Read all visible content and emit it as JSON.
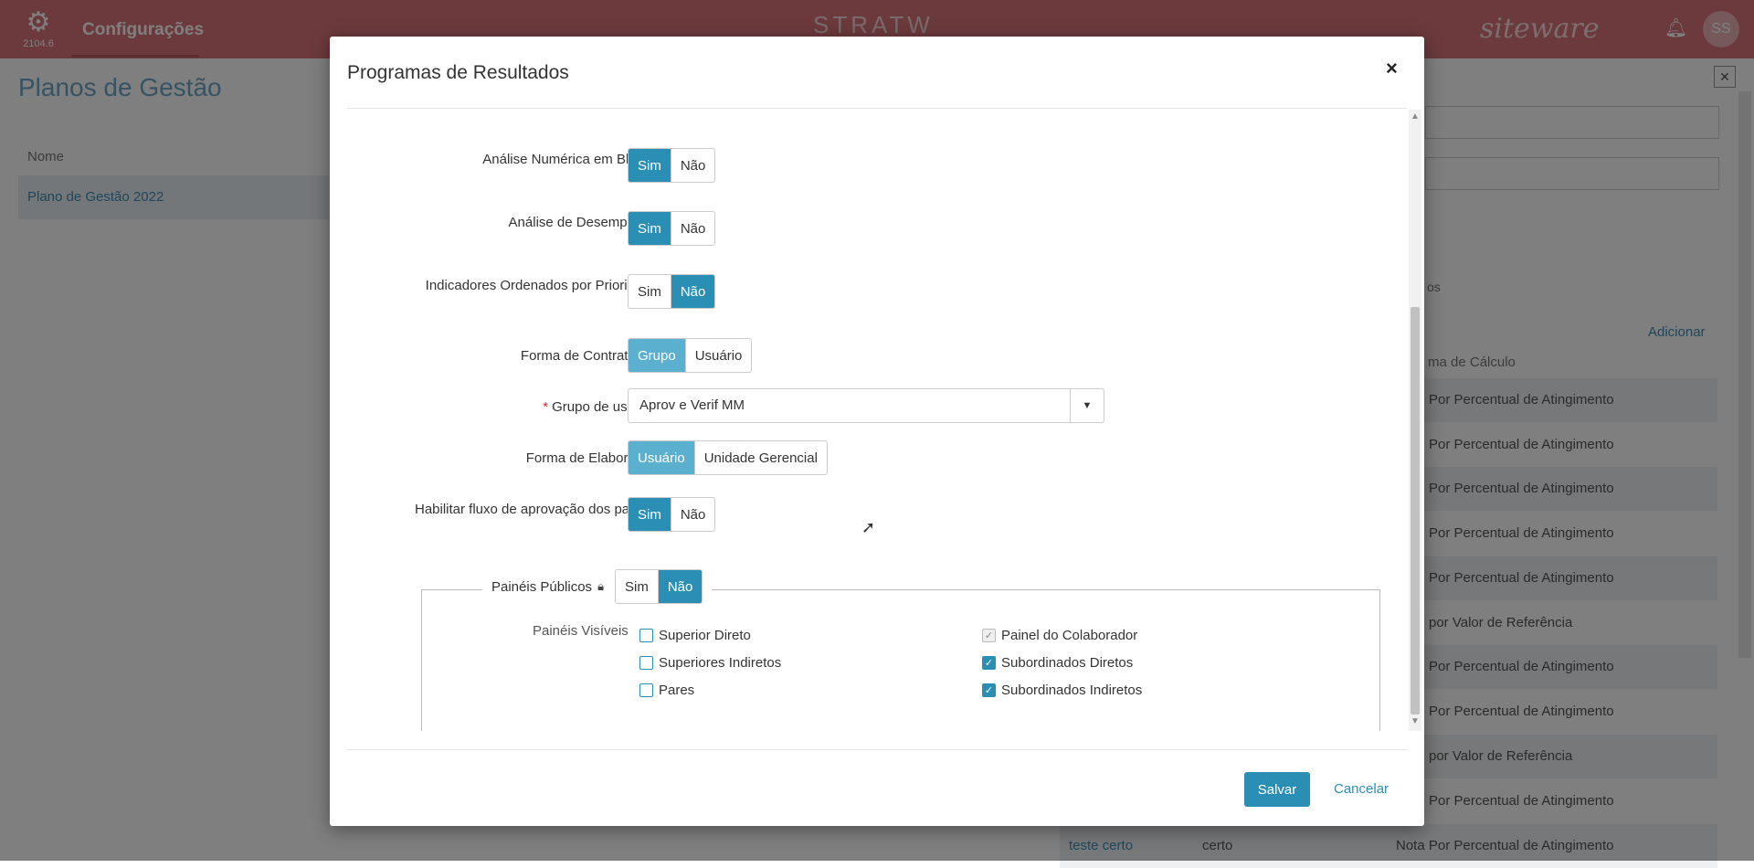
{
  "app": {
    "version": "2104.6",
    "title": "Configurações",
    "logo_text": "STRATW",
    "brand": "siteware",
    "avatar_initials": "SS"
  },
  "background": {
    "page_title": "Planos de Gestão",
    "column_name": "Nome",
    "plan_row": "Plano de Gestão 2022",
    "add_link": "Adicionar",
    "calc_header": "ma de Cálculo",
    "tab_partial": "os",
    "rows": [
      "Por Percentual de Atingimento",
      "Por Percentual de Atingimento",
      "Por Percentual de Atingimento",
      "Por Percentual de Atingimento",
      "Por Percentual de Atingimento",
      "por Valor de Referência",
      "Por Percentual de Atingimento",
      "Por Percentual de Atingimento",
      "por Valor de Referência",
      "Por Percentual de Atingimento"
    ],
    "last_row": {
      "name": "teste certo",
      "value": "certo",
      "calc": "Nota Por Percentual de Atingimento"
    }
  },
  "modal": {
    "title": "Programas de Resultados",
    "close_label": "×",
    "fields": {
      "analise_numerica": {
        "label": "Análise Numérica em Blocos",
        "options": [
          "Sim",
          "Não"
        ],
        "selected": "Sim"
      },
      "analise_desempenho": {
        "label": "Análise de Desempenho",
        "options": [
          "Sim",
          "Não"
        ],
        "selected": "Sim"
      },
      "indicadores_ordenados": {
        "label": "Indicadores Ordenados por Prioridade",
        "options": [
          "Sim",
          "Não"
        ],
        "selected": "Não"
      },
      "forma_contratacao": {
        "label": "Forma de Contratação",
        "options": [
          "Grupo",
          "Usuário"
        ],
        "selected": "Grupo"
      },
      "grupo_usuario": {
        "required_mark": "*",
        "label": "Grupo de usuário",
        "value": "Aprov e Verif MM"
      },
      "forma_elaboracao": {
        "label": "Forma de Elaboração",
        "options": [
          "Usuário",
          "Unidade Gerencial"
        ],
        "selected": "Usuário"
      },
      "fluxo_aprovacao": {
        "label": "Habilitar fluxo de aprovação dos painéis",
        "options": [
          "Sim",
          "Não"
        ],
        "selected": "Sim"
      }
    },
    "paineis_publicos": {
      "label": "Painéis Públicos",
      "options": [
        "Sim",
        "Não"
      ],
      "selected": "Não",
      "visible_label": "Painéis Visíveis",
      "checkboxes": [
        {
          "label": "Superior Direto",
          "checked": false
        },
        {
          "label": "Superiores Indiretos",
          "checked": false
        },
        {
          "label": "Pares",
          "checked": false
        },
        {
          "label": "Painel do Colaborador",
          "checked": true,
          "disabled": true
        },
        {
          "label": "Subordinados Diretos",
          "checked": true
        },
        {
          "label": "Subordinados Indiretos",
          "checked": true
        }
      ]
    },
    "save_label": "Salvar",
    "cancel_label": "Cancelar"
  },
  "colors": {
    "accent": "#2b8fb5",
    "topbar": "#d9747a"
  }
}
